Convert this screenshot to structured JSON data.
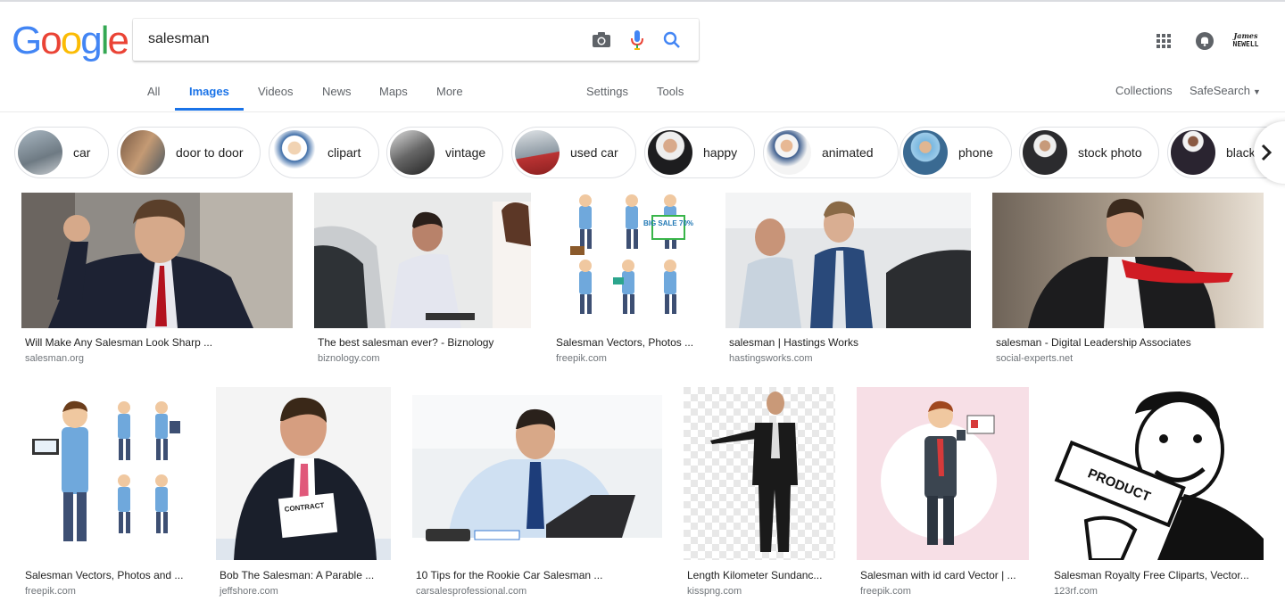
{
  "logo": {
    "letters": [
      "G",
      "o",
      "o",
      "g",
      "l",
      "e"
    ],
    "colors": [
      "#4285f4",
      "#ea4335",
      "#fbbc05",
      "#4285f4",
      "#34a853",
      "#ea4335"
    ]
  },
  "search": {
    "query": "salesman"
  },
  "icons": {
    "camera": "camera-icon",
    "mic": "microphone-icon",
    "search": "search-icon",
    "apps": "apps-grid-icon",
    "notifications": "notifications-icon"
  },
  "account": {
    "avatar_line1": "James",
    "avatar_line2": "NEWELL"
  },
  "tabs": [
    {
      "label": "All",
      "active": false
    },
    {
      "label": "Images",
      "active": true
    },
    {
      "label": "Videos",
      "active": false
    },
    {
      "label": "News",
      "active": false
    },
    {
      "label": "Maps",
      "active": false
    },
    {
      "label": "More",
      "active": false
    },
    {
      "label": "Settings",
      "active": false
    },
    {
      "label": "Tools",
      "active": false
    }
  ],
  "right_links": {
    "collections": "Collections",
    "safesearch": "SafeSearch"
  },
  "chips": [
    {
      "label": "car"
    },
    {
      "label": "door to door"
    },
    {
      "label": "clipart"
    },
    {
      "label": "vintage"
    },
    {
      "label": "used car"
    },
    {
      "label": "happy"
    },
    {
      "label": "animated"
    },
    {
      "label": "phone"
    },
    {
      "label": "stock photo"
    },
    {
      "label": "black"
    }
  ],
  "results": [
    {
      "title": "Will Make Any Salesman Look Sharp ...",
      "source": "salesman.org"
    },
    {
      "title": "The best salesman ever? - Biznology",
      "source": "biznology.com"
    },
    {
      "title": "Salesman Vectors, Photos ...",
      "source": "freepik.com"
    },
    {
      "title": "salesman | Hastings Works",
      "source": "hastingsworks.com"
    },
    {
      "title": "salesman - Digital Leadership Associates",
      "source": "social-experts.net"
    },
    {
      "title": "Salesman Vectors, Photos and ...",
      "source": "freepik.com"
    },
    {
      "title": "Bob The Salesman: A Parable ...",
      "source": "jeffshore.com"
    },
    {
      "title": "10 Tips for the Rookie Car Salesman ...",
      "source": "carsalesprofessional.com"
    },
    {
      "title": "Length Kilometer Sundanc...",
      "source": "kisspng.com"
    },
    {
      "title": "Salesman with id card Vector | ...",
      "source": "freepik.com"
    },
    {
      "title": "Salesman Royalty Free Cliparts, Vector...",
      "source": "123rf.com"
    }
  ],
  "image_texts": {
    "contract": "CONTRACT",
    "sale_sign": "BIG SALE 70%",
    "product": "PRODUCT"
  }
}
